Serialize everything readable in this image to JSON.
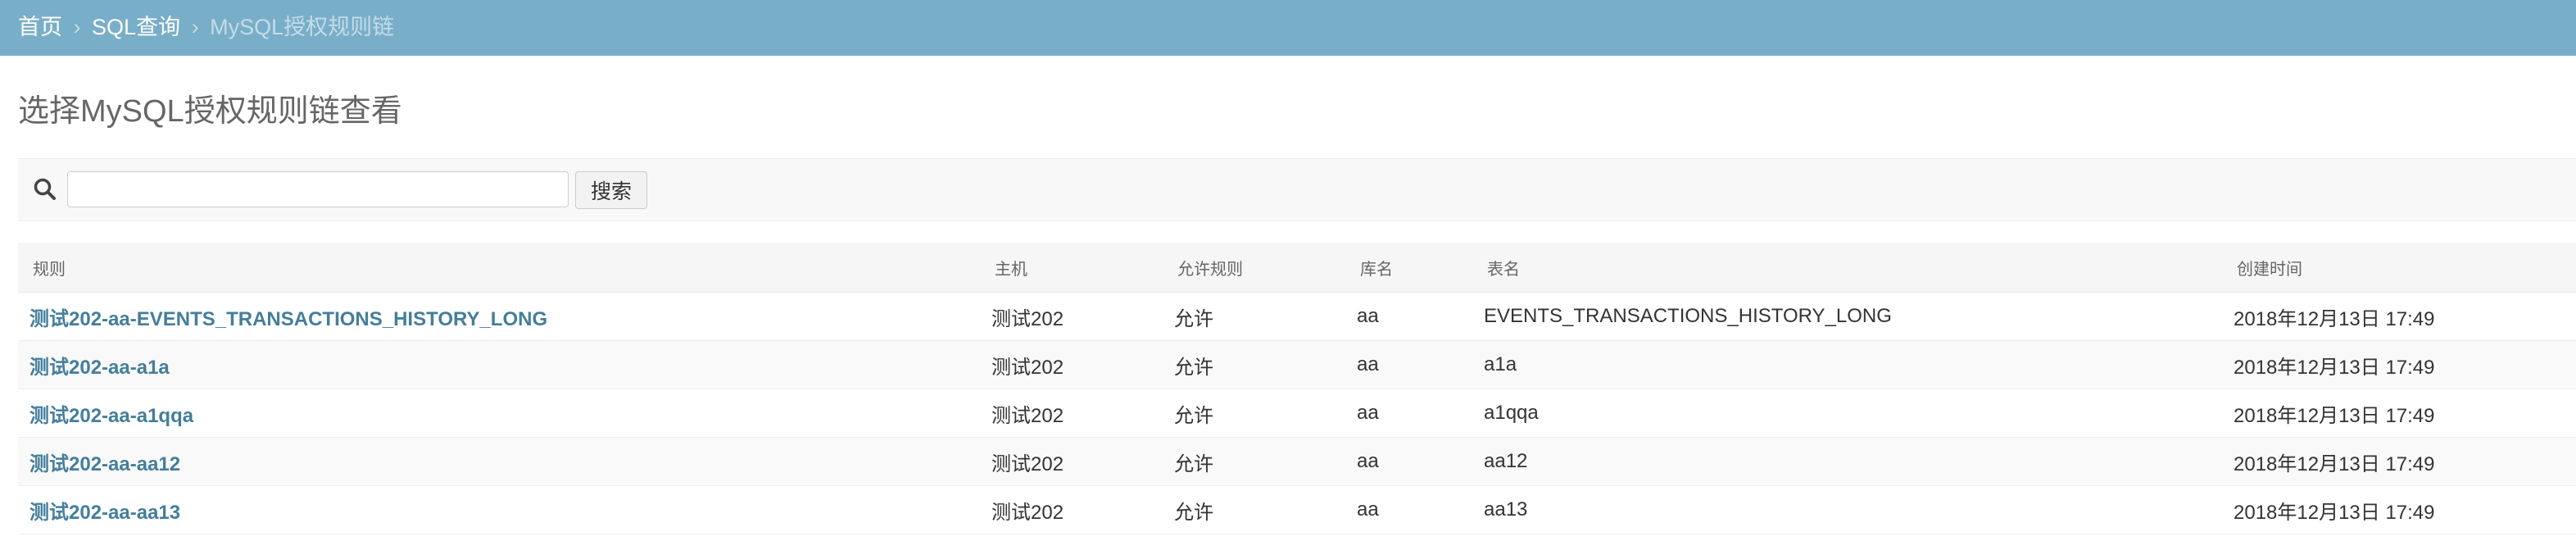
{
  "breadcrumb": {
    "items": [
      {
        "label": "首页"
      },
      {
        "label": "SQL查询"
      }
    ],
    "separator": "›",
    "current": "MySQL授权规则链"
  },
  "page": {
    "title": "选择MySQL授权规则链查看"
  },
  "search": {
    "icon": "search-icon",
    "value": "",
    "placeholder": "",
    "button_label": "搜索"
  },
  "table": {
    "columns": [
      "规则",
      "主机",
      "允许规则",
      "库名",
      "表名",
      "创建时间"
    ],
    "rows": [
      {
        "rule": "测试202-aa-EVENTS_TRANSACTIONS_HISTORY_LONG",
        "host": "测试202",
        "allow": "允许",
        "db": "aa",
        "table": "EVENTS_TRANSACTIONS_HISTORY_LONG",
        "created": "2018年12月13日 17:49"
      },
      {
        "rule": "测试202-aa-a1a",
        "host": "测试202",
        "allow": "允许",
        "db": "aa",
        "table": "a1a",
        "created": "2018年12月13日 17:49"
      },
      {
        "rule": "测试202-aa-a1qqa",
        "host": "测试202",
        "allow": "允许",
        "db": "aa",
        "table": "a1qqa",
        "created": "2018年12月13日 17:49"
      },
      {
        "rule": "测试202-aa-aa12",
        "host": "测试202",
        "allow": "允许",
        "db": "aa",
        "table": "aa12",
        "created": "2018年12月13日 17:49"
      },
      {
        "rule": "测试202-aa-aa13",
        "host": "测试202",
        "allow": "允许",
        "db": "aa",
        "table": "aa13",
        "created": "2018年12月13日 17:49"
      }
    ]
  },
  "colors": {
    "header_bg": "#79aec8",
    "link": "#447e9b",
    "muted_text": "#666666"
  }
}
